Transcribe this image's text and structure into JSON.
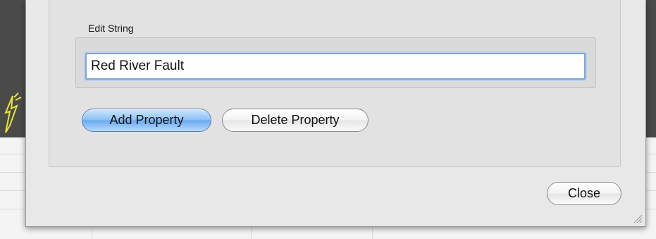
{
  "dialog": {
    "group_label": "Edit String",
    "string_field": {
      "value": "Red River Fault"
    },
    "buttons": {
      "add_property": "Add Property",
      "delete_property": "Delete Property",
      "close": "Close"
    }
  },
  "icons": {
    "resize_grip": "resize-grip-icon",
    "background_annotation": "scribble-annotation-icon"
  },
  "colors": {
    "primary_button": "#8cc1f4",
    "focus_ring": "#7fa6d6",
    "dialog_background": "#e8e8e8"
  }
}
